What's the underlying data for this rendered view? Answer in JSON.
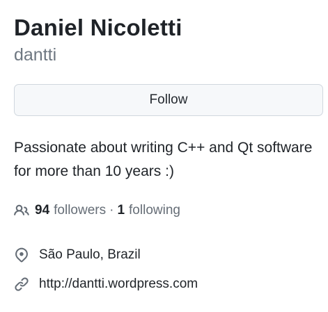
{
  "profile": {
    "display_name": "Daniel Nicoletti",
    "username": "dantti"
  },
  "actions": {
    "follow_label": "Follow"
  },
  "bio": "Passionate about writing C++ and Qt software for more than 10 years :)",
  "stats": {
    "followers_count": "94",
    "followers_label": "followers",
    "separator": "·",
    "following_count": "1",
    "following_label": "following"
  },
  "details": {
    "location": "São Paulo, Brazil",
    "website": "http://dantti.wordpress.com"
  },
  "icons": {
    "people": "people-icon",
    "location": "location-pin-icon",
    "link": "link-icon"
  },
  "colors": {
    "text_primary": "#1f2328",
    "text_muted": "#656d76",
    "button_bg": "#f6f8fa",
    "button_border": "#d0d7de"
  }
}
